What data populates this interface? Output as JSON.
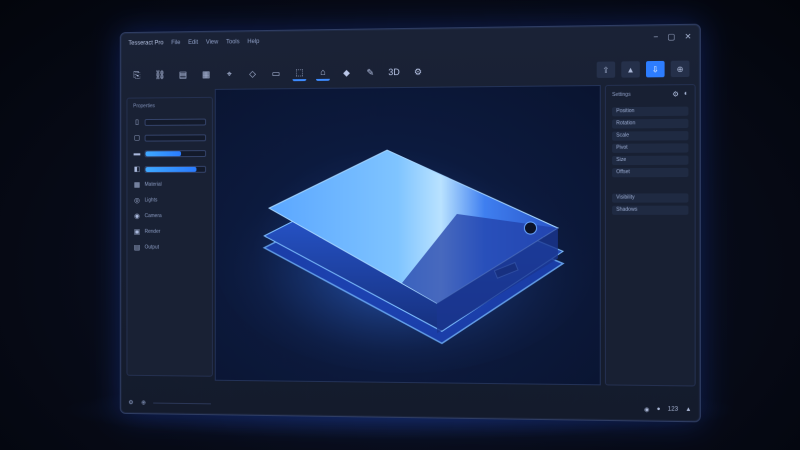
{
  "titlebar": {
    "app_title": "Tesseract Pro",
    "menu": [
      "File",
      "Edit",
      "View",
      "Tools",
      "Help"
    ],
    "controls": [
      "−",
      "▢",
      "✕"
    ]
  },
  "toolbar": {
    "tools": [
      {
        "name": "open-icon",
        "glyph": "⎘"
      },
      {
        "name": "link-icon",
        "glyph": "⛓"
      },
      {
        "name": "layers-icon",
        "glyph": "▤"
      },
      {
        "name": "grid-icon",
        "glyph": "▦"
      },
      {
        "name": "pin-icon",
        "glyph": "⌖"
      },
      {
        "name": "shape-icon",
        "glyph": "◇"
      },
      {
        "name": "frame-icon",
        "glyph": "▭"
      },
      {
        "name": "select-icon",
        "glyph": "⬚"
      },
      {
        "name": "home-icon",
        "glyph": "⌂"
      },
      {
        "name": "object-icon",
        "glyph": "◆"
      },
      {
        "name": "pen-icon",
        "glyph": "✎"
      },
      {
        "name": "3d-icon",
        "glyph": "3D"
      },
      {
        "name": "settings-icon",
        "glyph": "⚙"
      }
    ],
    "right_buttons": [
      {
        "name": "export-icon",
        "glyph": "⇪",
        "primary": false
      },
      {
        "name": "mountain-icon",
        "glyph": "▲",
        "primary": false
      },
      {
        "name": "render-icon",
        "glyph": "⇩",
        "primary": true
      },
      {
        "name": "share-icon",
        "glyph": "⊕",
        "primary": false
      }
    ]
  },
  "left_panel": {
    "header": "Properties",
    "rows": [
      {
        "icon": "▯",
        "label": "",
        "fill": 0
      },
      {
        "icon": "▢",
        "label": "",
        "fill": 0
      },
      {
        "icon": "▬",
        "label": "",
        "fill": 0.6
      },
      {
        "icon": "◧",
        "label": "",
        "fill": 0.85
      },
      {
        "icon": "▦",
        "label": "Material",
        "fill": null
      },
      {
        "icon": "◎",
        "label": "Lights",
        "fill": null
      },
      {
        "icon": "◉",
        "label": "Camera",
        "fill": null
      },
      {
        "icon": "▣",
        "label": "Render",
        "fill": null
      },
      {
        "icon": "▤",
        "label": "Output",
        "fill": null
      }
    ]
  },
  "right_panel": {
    "header": "Settings",
    "icons": [
      "⚙",
      "◐"
    ],
    "rows_a": [
      "Position",
      "Rotation",
      "Scale",
      "Pivot",
      "Size",
      "Offset"
    ],
    "rows_b": [
      "Visibility",
      "Shadows"
    ]
  },
  "statusbar": {
    "left": [
      "⚙",
      "⊕"
    ],
    "right": [
      "◉",
      "●",
      "123",
      "▲"
    ]
  },
  "colors": {
    "accent": "#2d7dff",
    "device_glow": "#3d8bff",
    "background": "#070b18"
  }
}
